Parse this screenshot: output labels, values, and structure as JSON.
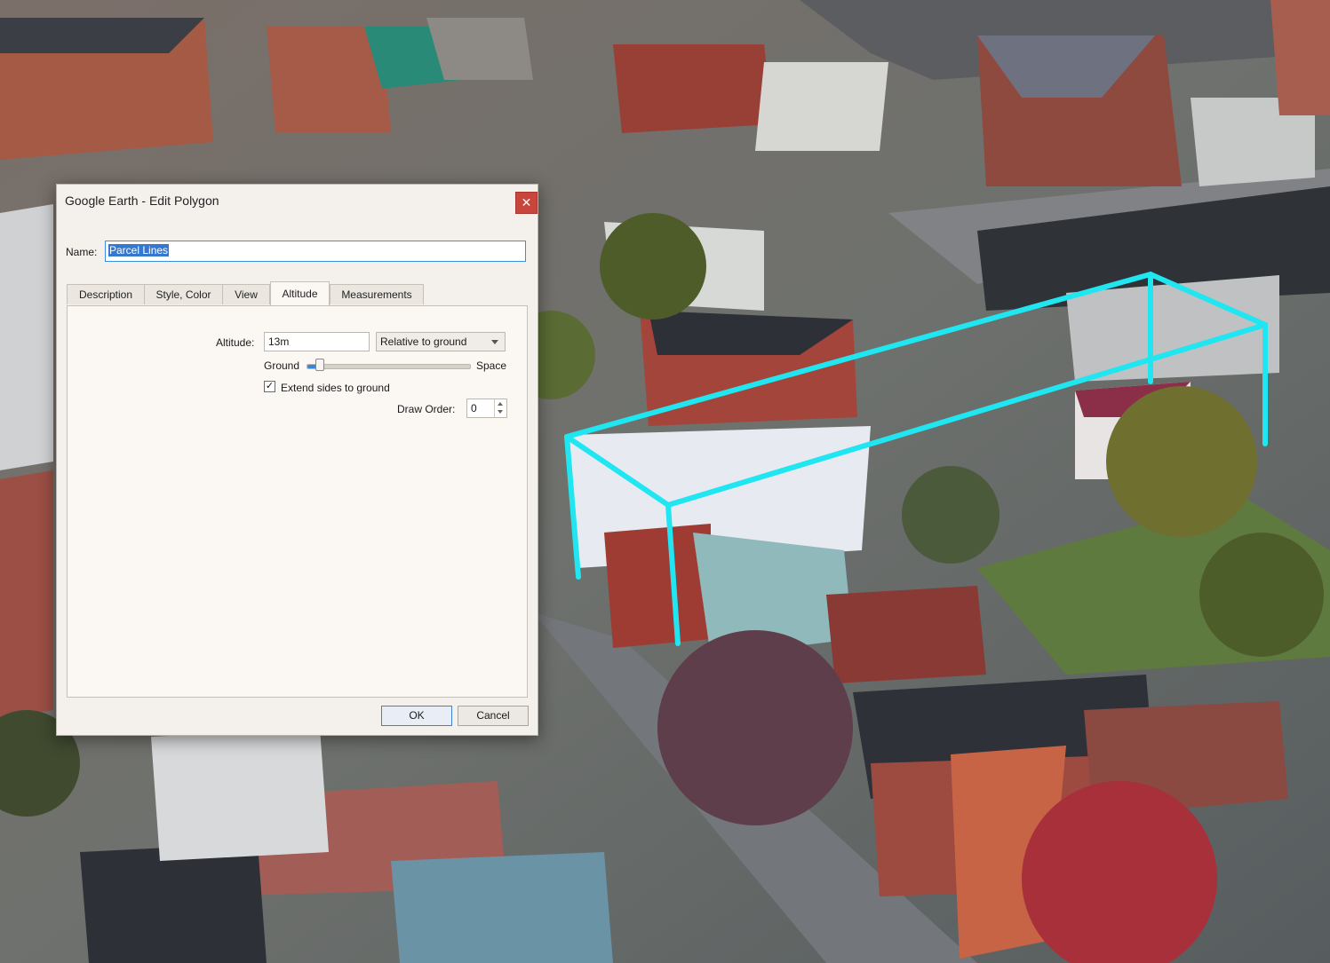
{
  "dialog": {
    "title": "Google Earth - Edit Polygon",
    "close_icon": "close-icon",
    "name_label": "Name:",
    "name_value": "Parcel Lines",
    "tabs": [
      {
        "label": "Description",
        "active": false
      },
      {
        "label": "Style, Color",
        "active": false
      },
      {
        "label": "View",
        "active": false
      },
      {
        "label": "Altitude",
        "active": true
      },
      {
        "label": "Measurements",
        "active": false
      }
    ],
    "altitude": {
      "label": "Altitude:",
      "value": "13m",
      "mode": "Relative to ground",
      "slider_min_label": "Ground",
      "slider_max_label": "Space",
      "slider_level": 0.08,
      "extend_label": "Extend sides to ground",
      "extend_checked": true,
      "draw_order_label": "Draw Order:",
      "draw_order_value": "0"
    },
    "ok_label": "OK",
    "cancel_label": "Cancel"
  },
  "colors": {
    "polygon_outline": "#1fe6f0",
    "close_button": "#c9463d",
    "selection": "#3478d1"
  }
}
